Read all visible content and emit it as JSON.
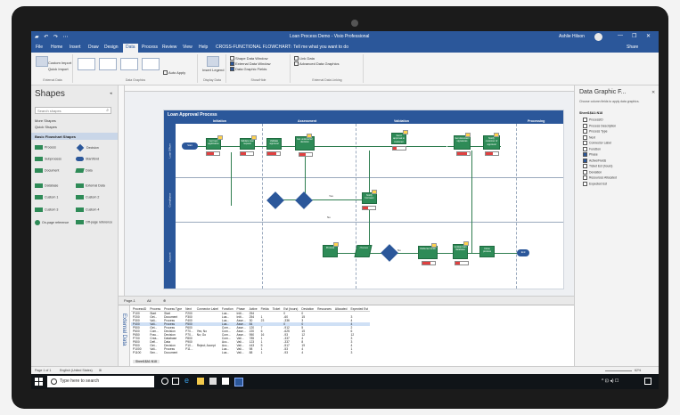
{
  "window": {
    "title": "Loan Process Demo - Visio Professional",
    "user": "Ashlie Hilson",
    "quick_access": "▰ ↶ ↷ ⋯",
    "controls": {
      "minimize": "—",
      "restore": "❐",
      "close": "✕"
    }
  },
  "ribbon": {
    "tabs": [
      "File",
      "Home",
      "Insert",
      "Draw",
      "Design",
      "Data",
      "Process",
      "Review",
      "View",
      "Help",
      "CROSS-FUNCTIONAL FLOWCHART"
    ],
    "active_tab": "Data",
    "tell_me": "Tell me what you want to do",
    "share": "Share",
    "groups": [
      {
        "label": "External Data"
      },
      {
        "label": "Data Graphics"
      },
      {
        "label": "Display Data"
      },
      {
        "label": "Show/Hide"
      },
      {
        "label": "External Data Linking"
      }
    ],
    "commands": {
      "custom_import": "Custom Import",
      "quick_import": "Quick Import",
      "auto_apply": "Auto Apply",
      "insert_legend": "Insert Legend",
      "shape_data_window": "Shape Data Window",
      "external_data_window": "External Data Window",
      "data_graphic_fields": "Data Graphic Fields",
      "link_data": "Link Data",
      "advanced_data_graphics": "Advanced Data Graphics"
    }
  },
  "shapes_pane": {
    "title": "Shapes",
    "search_placeholder": "Search shapes",
    "more_shapes": "More Shapes",
    "quick_shapes": "Quick Shapes",
    "stencil": "Basic Flowchart Shapes",
    "items": [
      {
        "label": "Process",
        "icon": "rectangle-icon"
      },
      {
        "label": "Decision",
        "icon": "diamond-icon"
      },
      {
        "label": "Subprocess",
        "icon": "rectangle-icon"
      },
      {
        "label": "Start/End",
        "icon": "rectangle-icon"
      },
      {
        "label": "Document",
        "icon": "rectangle-icon"
      },
      {
        "label": "Data",
        "icon": "rectangle-icon"
      },
      {
        "label": "Database",
        "icon": "rectangle-icon"
      },
      {
        "label": "External Data",
        "icon": "rectangle-icon"
      },
      {
        "label": "Custom 1",
        "icon": "rectangle-icon"
      },
      {
        "label": "Custom 2",
        "icon": "rectangle-icon"
      },
      {
        "label": "Custom 3",
        "icon": "rectangle-icon"
      },
      {
        "label": "Custom 4",
        "icon": "rectangle-icon"
      },
      {
        "label": "On-page reference",
        "icon": "rectangle-icon"
      },
      {
        "label": "Off-page reference",
        "icon": "rectangle-icon"
      }
    ]
  },
  "diagram": {
    "title": "Loan Approval Process",
    "phases": [
      "Initiation",
      "Assessment",
      "Validation",
      "Processing"
    ],
    "lanes": [
      "Loan Officer",
      "Compliance",
      "Account"
    ],
    "nodes": {
      "start": "Start",
      "n1": "Get loan application",
      "n2": "Validate loan request",
      "n3": "Validate approval",
      "n4": "Get underwriter decision",
      "n5": "Send approval to customer",
      "n6": "Get document signatures",
      "n7": "Notify customer of approval",
      "d1": "Compliant?",
      "d2": "Fraud check",
      "n8": "Notify borrower",
      "n9": "Process",
      "n10": "Process",
      "d3": "Validated?",
      "n11": "Disburse funds",
      "n12": "Update loan database",
      "n13": "Close process",
      "end": "End"
    },
    "connector_labels": {
      "yes": "Yes",
      "no": "No"
    },
    "data_bars": [
      0.6,
      0.4,
      0.7,
      0.5,
      0.3,
      0.8,
      0.55,
      0.45,
      0.65,
      0.35
    ]
  },
  "page_bar": {
    "page": "Page-1",
    "all": "All",
    "add": "⊕"
  },
  "external_data": {
    "label": "External Data",
    "columns": [
      "ProcessID",
      "Process",
      "Process Type",
      "Next",
      "Connector Label",
      "Function",
      "Phase",
      "Active",
      "Fielda",
      "Ticket",
      "Est (hours)",
      "Deviation",
      "Resources",
      "Allocated",
      "Expected Est"
    ],
    "rows": [
      [
        "P100",
        "Start",
        "Start",
        "P200",
        "",
        "Loa...",
        "Initi...",
        "254",
        "",
        "",
        "0",
        "0",
        "",
        "",
        ""
      ],
      [
        "P200",
        "Get...",
        "Document",
        "P300",
        "",
        "Loa...",
        "Initi...",
        "254",
        "1",
        "",
        "-60",
        "15",
        "",
        "",
        "3"
      ],
      [
        "P300",
        "Vali...",
        "Process",
        "P400",
        "",
        "Loa...",
        "Asse...",
        "30",
        "23",
        "",
        "-336",
        "3",
        "",
        "",
        "4"
      ],
      [
        "P400",
        "Vali...",
        "Process",
        "P500",
        "",
        "Loa...",
        "Asse...",
        "84",
        "",
        "",
        "0",
        "0",
        "",
        "",
        "4"
      ],
      [
        "P500",
        "Get...",
        "Process",
        "P600",
        "",
        "Com...",
        "Asse...",
        "120",
        "7",
        "",
        "-912",
        "5",
        "",
        "",
        "2"
      ],
      [
        "P600",
        "Com...",
        "Decision",
        "P70...",
        "Yes; No",
        "Com...",
        "Asse...",
        "220",
        "6",
        "",
        "-625",
        "15",
        "",
        "",
        "6"
      ],
      [
        "P650",
        "Frau...",
        "Decision",
        "P70...",
        "No; Go",
        "Com...",
        "Asse...",
        "950",
        "16",
        "",
        "-93",
        "12",
        "",
        "",
        "12"
      ],
      [
        "P700",
        "Crea...",
        "Database",
        "P800",
        "",
        "Com...",
        "Vali...",
        "785",
        "1",
        "",
        "-337",
        "4",
        "",
        "",
        "3"
      ],
      [
        "P800",
        "Defi...",
        "Data",
        "P900",
        "",
        "Acc...",
        "Vali...",
        "123",
        "1",
        "",
        "-337",
        "8",
        "",
        "",
        "3"
      ],
      [
        "P900",
        "Get...",
        "Decision",
        "P10...",
        "Reject; Accept",
        "Acc...",
        "Vali...",
        "443",
        "5",
        "",
        "-517",
        "19",
        "",
        "",
        "4"
      ],
      [
        "P1000",
        "Vali...",
        "Process",
        "P11...",
        "",
        "Loa...",
        "Vali...",
        "98",
        "1",
        "",
        "-53",
        "4",
        "",
        "",
        "1"
      ],
      [
        "P1100",
        "Sen...",
        "Document",
        "",
        "",
        "Loa...",
        "Vali...",
        "88",
        "1",
        "",
        "-93",
        "4",
        "",
        "",
        "3"
      ]
    ],
    "sheet_tab": "Sheet1$A1:N18"
  },
  "data_graphic_pane": {
    "title": "Data Graphic F...",
    "description": "Choose column fields to apply data graphics.",
    "section": "Sheet1$A1:N18",
    "fields": [
      {
        "label": "ProcessID",
        "checked": false
      },
      {
        "label": "Process Description",
        "checked": false
      },
      {
        "label": "Process Type",
        "checked": false
      },
      {
        "label": "Next",
        "checked": false
      },
      {
        "label": "Connector Label",
        "checked": false
      },
      {
        "label": "Function",
        "checked": false
      },
      {
        "label": "Phase",
        "checked": true
      },
      {
        "label": "Active/Fields",
        "checked": true
      },
      {
        "label": "Ticket Est (hours)",
        "checked": false
      },
      {
        "label": "Deviation",
        "checked": false
      },
      {
        "label": "Resources Allocated",
        "checked": false
      },
      {
        "label": "Expected Est",
        "checked": false
      }
    ]
  },
  "status_bar": {
    "page": "Page 1 of 1",
    "language": "English (United States)",
    "zoom": "62%"
  },
  "taskbar": {
    "search_placeholder": "Type here to search",
    "tray": "^ ⊡ ◂) ☐"
  }
}
